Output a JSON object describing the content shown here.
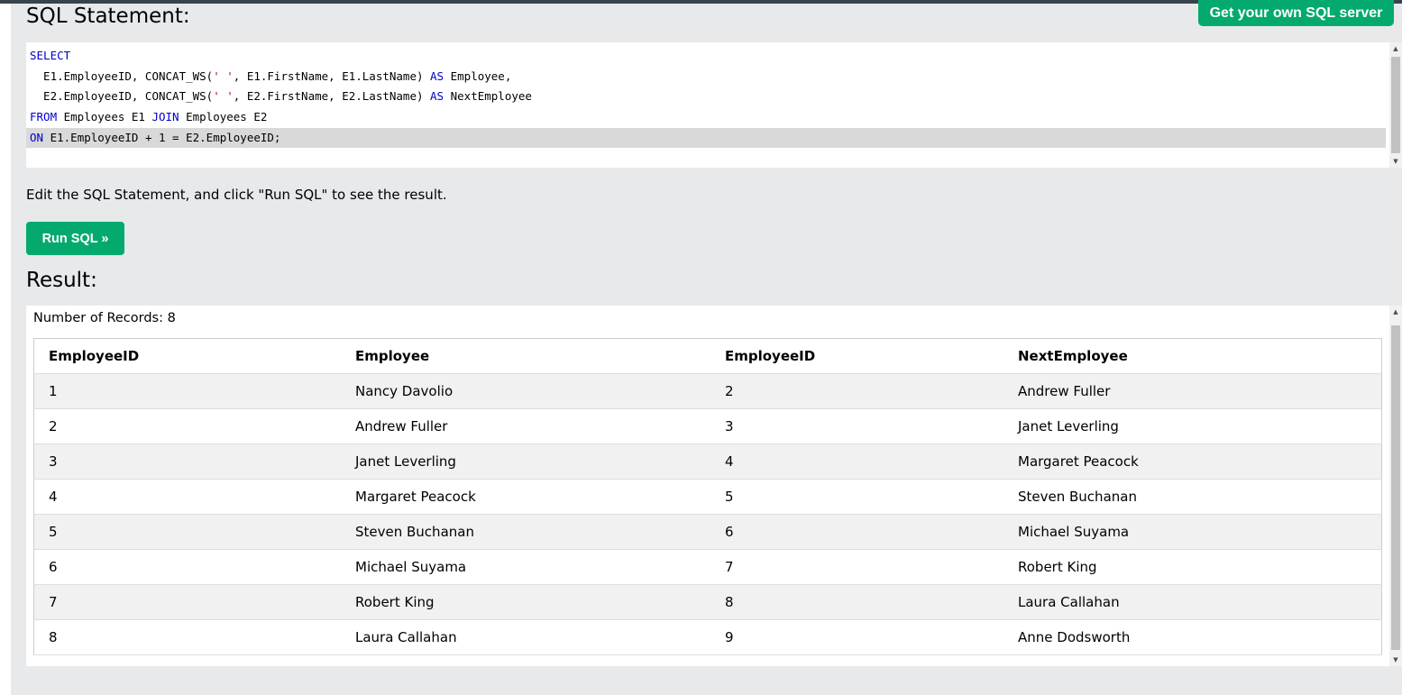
{
  "header": {
    "title": "SQL Statement:",
    "server_button": "Get your own SQL server"
  },
  "editor": {
    "lines": [
      [
        {
          "t": "SELECT",
          "k": "kw"
        }
      ],
      [
        {
          "t": "  E1.EmployeeID, CONCAT_WS("
        },
        {
          "t": "' '",
          "k": "str"
        },
        {
          "t": ", E1.FirstName, E1.LastName) "
        },
        {
          "t": "AS",
          "k": "kw"
        },
        {
          "t": " Employee,"
        }
      ],
      [
        {
          "t": "  E2.EmployeeID, CONCAT_WS("
        },
        {
          "t": "' '",
          "k": "str"
        },
        {
          "t": ", E2.FirstName, E2.LastName) "
        },
        {
          "t": "AS",
          "k": "kw"
        },
        {
          "t": " NextEmployee"
        }
      ],
      [
        {
          "t": "FROM",
          "k": "kw"
        },
        {
          "t": " Employees E1 "
        },
        {
          "t": "JOIN",
          "k": "kw"
        },
        {
          "t": " Employees E2"
        }
      ],
      [
        {
          "t": "ON",
          "k": "kw"
        },
        {
          "t": " E1.EmployeeID + 1 = E2.EmployeeID;"
        }
      ]
    ],
    "active_line": 4
  },
  "instructions": "Edit the SQL Statement, and click \"Run SQL\" to see the result.",
  "run_button": "Run SQL »",
  "result": {
    "title": "Result:",
    "records_label": "Number of Records: 8",
    "columns": [
      "EmployeeID",
      "Employee",
      "EmployeeID",
      "NextEmployee"
    ],
    "rows": [
      [
        "1",
        "Nancy Davolio",
        "2",
        "Andrew Fuller"
      ],
      [
        "2",
        "Andrew Fuller",
        "3",
        "Janet Leverling"
      ],
      [
        "3",
        "Janet Leverling",
        "4",
        "Margaret Peacock"
      ],
      [
        "4",
        "Margaret Peacock",
        "5",
        "Steven Buchanan"
      ],
      [
        "5",
        "Steven Buchanan",
        "6",
        "Michael Suyama"
      ],
      [
        "6",
        "Michael Suyama",
        "7",
        "Robert King"
      ],
      [
        "7",
        "Robert King",
        "8",
        "Laura Callahan"
      ],
      [
        "8",
        "Laura Callahan",
        "9",
        "Anne Dodsworth"
      ]
    ]
  },
  "icons": {
    "scroll_up": "▲",
    "scroll_down": "▼"
  },
  "colors": {
    "accent": "#04aa6d",
    "keyword": "#0000cc",
    "string": "#aa1111"
  }
}
